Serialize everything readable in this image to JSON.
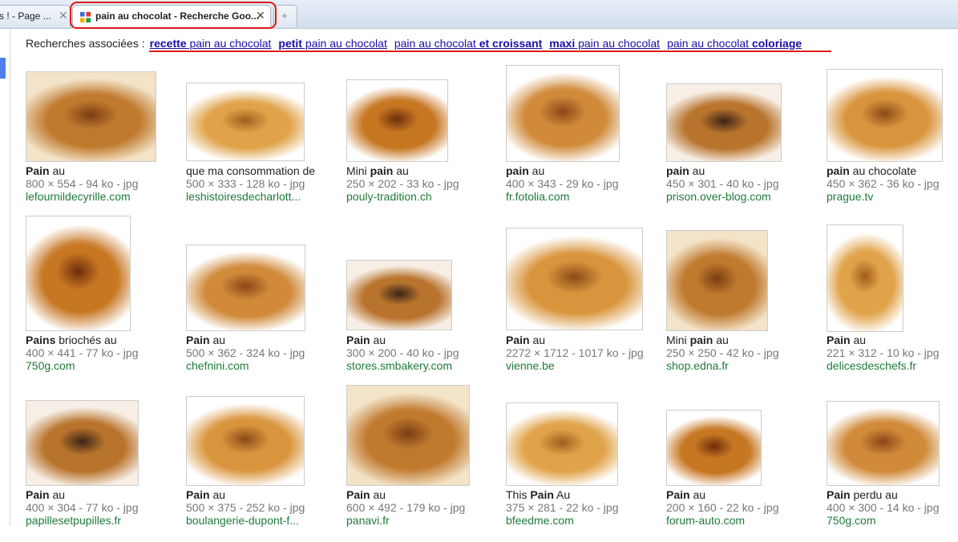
{
  "tabs": [
    {
      "label": "s ! - Page ...",
      "close": "✕"
    },
    {
      "label": "pain au chocolat - Recherche Goo...",
      "close": "✕"
    },
    {
      "label": "+"
    }
  ],
  "related": {
    "label": "Recherches associées :",
    "links": [
      {
        "bold": "recette",
        "text": " pain au chocolat"
      },
      {
        "bold": "petit",
        "text": " pain au chocolat"
      },
      {
        "text": "pain au chocolat ",
        "bold": "et croissant",
        "boldFirst": false
      },
      {
        "bold": "maxi",
        "text": " pain au chocolat"
      },
      {
        "text": "pain au chocolat ",
        "bold": "coloriage",
        "boldFirst": false
      }
    ]
  },
  "results": [
    [
      {
        "b": "Pain",
        "t": " au",
        "meta": "800 × 554 - 94 ko - jpg",
        "src": "lefournildecyrille.com"
      },
      {
        "b": "",
        "t": "que ma consommation de",
        "meta": "500 × 333 - 128 ko - jpg",
        "src": "leshistoiresdecharlott..."
      },
      {
        "pre": "Mini ",
        "b": "pain",
        "t": " au",
        "meta": "250 × 202 - 33 ko - jpg",
        "src": "pouly-tradition.ch"
      },
      {
        "b": "pain",
        "t": " au",
        "meta": "400 × 343 - 29 ko - jpg",
        "src": "fr.fotolia.com"
      },
      {
        "b": "pain",
        "t": " au",
        "meta": "450 × 301 - 40 ko - jpg",
        "src": "prison.over-blog.com"
      },
      {
        "b": "pain",
        "t": " au chocolate",
        "meta": "450 × 362 - 36 ko - jpg",
        "src": "prague.tv"
      }
    ],
    [
      {
        "b": "Pains",
        "t": " briochés au",
        "meta": "400 × 441 - 77 ko - jpg",
        "src": "750g.com"
      },
      {
        "b": "Pain",
        "t": " au",
        "meta": "500 × 362 - 324 ko - jpg",
        "src": "chefnini.com"
      },
      {
        "b": "Pain",
        "t": " au",
        "meta": "300 × 200 - 40 ko - jpg",
        "src": "stores.smbakery.com"
      },
      {
        "b": "Pain",
        "t": " au",
        "meta": "2272 × 1712 - 1017 ko - jpg",
        "src": "vienne.be"
      },
      {
        "pre": "Mini ",
        "b": "pain",
        "t": " au",
        "meta": "250 × 250 - 42 ko - jpg",
        "src": "shop.edna.fr"
      },
      {
        "b": "Pain",
        "t": " au",
        "meta": "221 × 312 - 10 ko - jpg",
        "src": "delicesdeschefs.fr"
      }
    ],
    [
      {
        "b": "Pain",
        "t": " au",
        "meta": "400 × 304 - 77 ko - jpg",
        "src": "papillesetpupilles.fr"
      },
      {
        "b": "Pain",
        "t": " au",
        "meta": "500 × 375 - 252 ko - jpg",
        "src": "boulangerie-dupont-f..."
      },
      {
        "b": "Pain",
        "t": " au",
        "meta": "600 × 492 - 179 ko - jpg",
        "src": "panavi.fr"
      },
      {
        "pre": "This ",
        "b": "Pain",
        "t": " Au",
        "meta": "375 × 281 - 22 ko - jpg",
        "src": "bfeedme.com"
      },
      {
        "b": "Pain",
        "t": " au",
        "meta": "200 × 160 - 22 ko - jpg",
        "src": "forum-auto.com"
      },
      {
        "b": "Pain",
        "t": " perdu au",
        "meta": "400 × 300 - 14 ko - jpg",
        "src": "750g.com"
      }
    ]
  ],
  "colors": {
    "link": "#1a0dab",
    "source": "#1e7a3a",
    "meta": "#777777",
    "highlight": "#e01818"
  }
}
